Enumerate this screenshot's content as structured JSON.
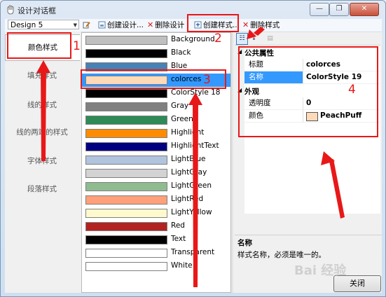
{
  "window": {
    "title": "设计对话框",
    "minimize_glyph": "—",
    "restore_glyph": "❐",
    "close_glyph": "✕"
  },
  "toolbar": {
    "design_combo_value": "Design 5",
    "create_design_label": "创建设计...",
    "delete_design_label": "删除设计",
    "create_style_label": "创建样式...",
    "delete_style_label": "删除样式"
  },
  "sidebar": {
    "items": [
      {
        "label": "颜色样式",
        "selected": true
      },
      {
        "label": "填充样式"
      },
      {
        "label": "线的样式"
      },
      {
        "label": "线的两端的样式"
      },
      {
        "label": "字体样式"
      },
      {
        "label": "段落样式"
      }
    ]
  },
  "color_list": [
    {
      "name": "Background",
      "color": "#c0c0c0"
    },
    {
      "name": "Black",
      "color": "#000000"
    },
    {
      "name": "Blue",
      "color": "#4682b4"
    },
    {
      "name": "colorces",
      "color": "#ffdab9",
      "selected": true
    },
    {
      "name": "ColorStyle 18",
      "color": "#000000"
    },
    {
      "name": "Gray",
      "color": "#808080"
    },
    {
      "name": "Green",
      "color": "#2e8b57"
    },
    {
      "name": "Highlight",
      "color": "#ff8c00"
    },
    {
      "name": "HighlightText",
      "color": "#000080"
    },
    {
      "name": "LightBlue",
      "color": "#b0c4de"
    },
    {
      "name": "LightGray",
      "color": "#d3d3d3"
    },
    {
      "name": "LightGreen",
      "color": "#8fbc8f"
    },
    {
      "name": "LightRed",
      "color": "#ffa07a"
    },
    {
      "name": "LightYellow",
      "color": "#fffacd"
    },
    {
      "name": "Red",
      "color": "#b22222"
    },
    {
      "name": "Text",
      "color": "#000000"
    },
    {
      "name": "Transparent",
      "color": "#ffffff"
    },
    {
      "name": "White",
      "color": "#ffffff"
    }
  ],
  "property_grid": {
    "cat_common": "公共属性",
    "cat_appearance": "外观",
    "title_label": "标题",
    "title_value": "colorces",
    "name_label": "名称",
    "name_value": "ColorStyle 19",
    "opacity_label": "透明度",
    "opacity_value": "0",
    "color_label": "颜色",
    "color_value": "PeachPuff",
    "color_swatch": "#ffdab9"
  },
  "description": {
    "heading": "名称",
    "text": "样式名称，必须是唯一的。"
  },
  "close_button": "关闭",
  "annotations": {
    "n1": "1",
    "n2": "2",
    "n3": "3",
    "n4": "4"
  },
  "watermark": "Bai 经验"
}
